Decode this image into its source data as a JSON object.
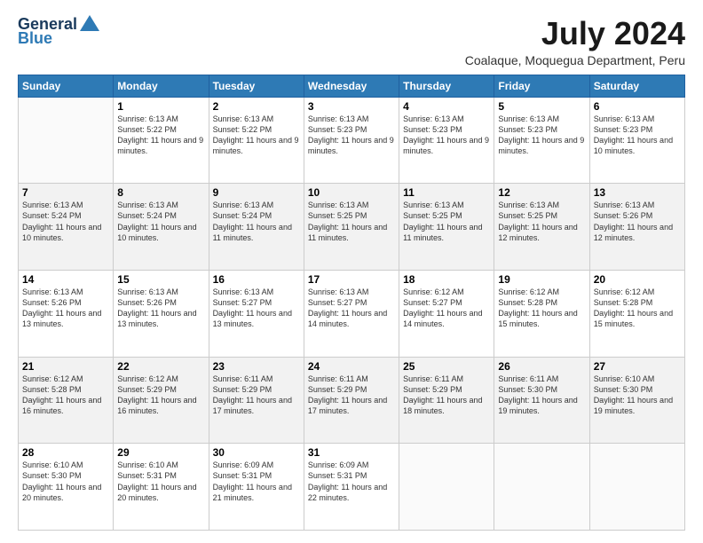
{
  "header": {
    "logo_line1": "General",
    "logo_line2": "Blue",
    "month_year": "July 2024",
    "location": "Coalaque, Moquegua Department, Peru"
  },
  "days_of_week": [
    "Sunday",
    "Monday",
    "Tuesday",
    "Wednesday",
    "Thursday",
    "Friday",
    "Saturday"
  ],
  "weeks": [
    [
      {
        "day": "",
        "sunrise": "",
        "sunset": "",
        "daylight": ""
      },
      {
        "day": "1",
        "sunrise": "Sunrise: 6:13 AM",
        "sunset": "Sunset: 5:22 PM",
        "daylight": "Daylight: 11 hours and 9 minutes."
      },
      {
        "day": "2",
        "sunrise": "Sunrise: 6:13 AM",
        "sunset": "Sunset: 5:22 PM",
        "daylight": "Daylight: 11 hours and 9 minutes."
      },
      {
        "day": "3",
        "sunrise": "Sunrise: 6:13 AM",
        "sunset": "Sunset: 5:23 PM",
        "daylight": "Daylight: 11 hours and 9 minutes."
      },
      {
        "day": "4",
        "sunrise": "Sunrise: 6:13 AM",
        "sunset": "Sunset: 5:23 PM",
        "daylight": "Daylight: 11 hours and 9 minutes."
      },
      {
        "day": "5",
        "sunrise": "Sunrise: 6:13 AM",
        "sunset": "Sunset: 5:23 PM",
        "daylight": "Daylight: 11 hours and 9 minutes."
      },
      {
        "day": "6",
        "sunrise": "Sunrise: 6:13 AM",
        "sunset": "Sunset: 5:23 PM",
        "daylight": "Daylight: 11 hours and 10 minutes."
      }
    ],
    [
      {
        "day": "7",
        "sunrise": "Sunrise: 6:13 AM",
        "sunset": "Sunset: 5:24 PM",
        "daylight": "Daylight: 11 hours and 10 minutes."
      },
      {
        "day": "8",
        "sunrise": "Sunrise: 6:13 AM",
        "sunset": "Sunset: 5:24 PM",
        "daylight": "Daylight: 11 hours and 10 minutes."
      },
      {
        "day": "9",
        "sunrise": "Sunrise: 6:13 AM",
        "sunset": "Sunset: 5:24 PM",
        "daylight": "Daylight: 11 hours and 11 minutes."
      },
      {
        "day": "10",
        "sunrise": "Sunrise: 6:13 AM",
        "sunset": "Sunset: 5:25 PM",
        "daylight": "Daylight: 11 hours and 11 minutes."
      },
      {
        "day": "11",
        "sunrise": "Sunrise: 6:13 AM",
        "sunset": "Sunset: 5:25 PM",
        "daylight": "Daylight: 11 hours and 11 minutes."
      },
      {
        "day": "12",
        "sunrise": "Sunrise: 6:13 AM",
        "sunset": "Sunset: 5:25 PM",
        "daylight": "Daylight: 11 hours and 12 minutes."
      },
      {
        "day": "13",
        "sunrise": "Sunrise: 6:13 AM",
        "sunset": "Sunset: 5:26 PM",
        "daylight": "Daylight: 11 hours and 12 minutes."
      }
    ],
    [
      {
        "day": "14",
        "sunrise": "Sunrise: 6:13 AM",
        "sunset": "Sunset: 5:26 PM",
        "daylight": "Daylight: 11 hours and 13 minutes."
      },
      {
        "day": "15",
        "sunrise": "Sunrise: 6:13 AM",
        "sunset": "Sunset: 5:26 PM",
        "daylight": "Daylight: 11 hours and 13 minutes."
      },
      {
        "day": "16",
        "sunrise": "Sunrise: 6:13 AM",
        "sunset": "Sunset: 5:27 PM",
        "daylight": "Daylight: 11 hours and 13 minutes."
      },
      {
        "day": "17",
        "sunrise": "Sunrise: 6:13 AM",
        "sunset": "Sunset: 5:27 PM",
        "daylight": "Daylight: 11 hours and 14 minutes."
      },
      {
        "day": "18",
        "sunrise": "Sunrise: 6:12 AM",
        "sunset": "Sunset: 5:27 PM",
        "daylight": "Daylight: 11 hours and 14 minutes."
      },
      {
        "day": "19",
        "sunrise": "Sunrise: 6:12 AM",
        "sunset": "Sunset: 5:28 PM",
        "daylight": "Daylight: 11 hours and 15 minutes."
      },
      {
        "day": "20",
        "sunrise": "Sunrise: 6:12 AM",
        "sunset": "Sunset: 5:28 PM",
        "daylight": "Daylight: 11 hours and 15 minutes."
      }
    ],
    [
      {
        "day": "21",
        "sunrise": "Sunrise: 6:12 AM",
        "sunset": "Sunset: 5:28 PM",
        "daylight": "Daylight: 11 hours and 16 minutes."
      },
      {
        "day": "22",
        "sunrise": "Sunrise: 6:12 AM",
        "sunset": "Sunset: 5:29 PM",
        "daylight": "Daylight: 11 hours and 16 minutes."
      },
      {
        "day": "23",
        "sunrise": "Sunrise: 6:11 AM",
        "sunset": "Sunset: 5:29 PM",
        "daylight": "Daylight: 11 hours and 17 minutes."
      },
      {
        "day": "24",
        "sunrise": "Sunrise: 6:11 AM",
        "sunset": "Sunset: 5:29 PM",
        "daylight": "Daylight: 11 hours and 17 minutes."
      },
      {
        "day": "25",
        "sunrise": "Sunrise: 6:11 AM",
        "sunset": "Sunset: 5:29 PM",
        "daylight": "Daylight: 11 hours and 18 minutes."
      },
      {
        "day": "26",
        "sunrise": "Sunrise: 6:11 AM",
        "sunset": "Sunset: 5:30 PM",
        "daylight": "Daylight: 11 hours and 19 minutes."
      },
      {
        "day": "27",
        "sunrise": "Sunrise: 6:10 AM",
        "sunset": "Sunset: 5:30 PM",
        "daylight": "Daylight: 11 hours and 19 minutes."
      }
    ],
    [
      {
        "day": "28",
        "sunrise": "Sunrise: 6:10 AM",
        "sunset": "Sunset: 5:30 PM",
        "daylight": "Daylight: 11 hours and 20 minutes."
      },
      {
        "day": "29",
        "sunrise": "Sunrise: 6:10 AM",
        "sunset": "Sunset: 5:31 PM",
        "daylight": "Daylight: 11 hours and 20 minutes."
      },
      {
        "day": "30",
        "sunrise": "Sunrise: 6:09 AM",
        "sunset": "Sunset: 5:31 PM",
        "daylight": "Daylight: 11 hours and 21 minutes."
      },
      {
        "day": "31",
        "sunrise": "Sunrise: 6:09 AM",
        "sunset": "Sunset: 5:31 PM",
        "daylight": "Daylight: 11 hours and 22 minutes."
      },
      {
        "day": "",
        "sunrise": "",
        "sunset": "",
        "daylight": ""
      },
      {
        "day": "",
        "sunrise": "",
        "sunset": "",
        "daylight": ""
      },
      {
        "day": "",
        "sunrise": "",
        "sunset": "",
        "daylight": ""
      }
    ]
  ]
}
